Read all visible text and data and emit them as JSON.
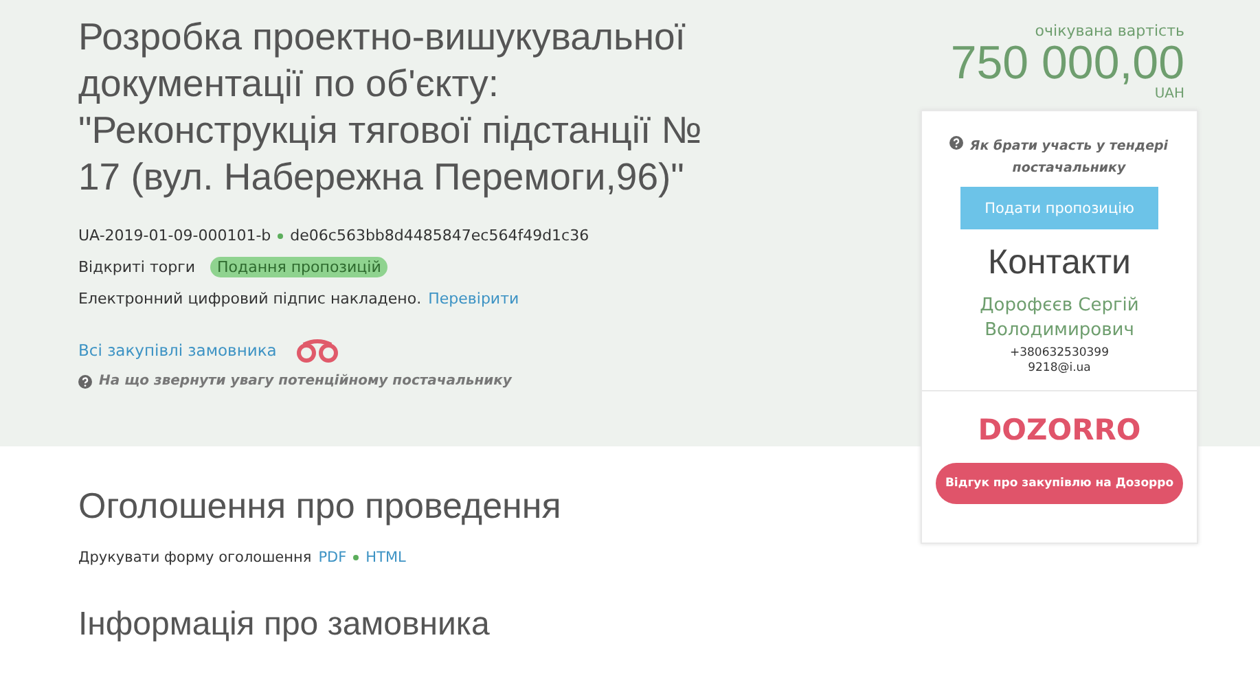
{
  "tender": {
    "title": "Розробка проектно-вишукувальної документації по об'єкту: \"Реконструкція тягової підстанції № 17 (вул. Набережна Перемоги,96)\"",
    "id": "UA-2019-01-09-000101-b",
    "hash": "de06c563bb8d4485847ec564f49d1c36",
    "procedure": "Відкриті торги",
    "status": "Подання пропозицій",
    "signature_text": "Електронний цифровий підпис накладено.",
    "signature_link": "Перевірити",
    "buyer_link": "Всі закупівлі замовника",
    "hint": "На що звернути увагу потенційному постачальнику"
  },
  "price": {
    "label": "очікувана вартість",
    "amount": "750 000,00",
    "currency": "UAH"
  },
  "card": {
    "help": "Як брати участь у тендері постачальнику",
    "submit_button": "Подати пропозицію",
    "contacts_title": "Контакти",
    "contact_name": "Дорофєєв Сергій Володимирович",
    "phone": "+380632530399",
    "email": "9218@i.ua",
    "logo": "DOZORRO",
    "feedback_button": "Відгук про закупівлю на Дозорро"
  },
  "sections": [
    {
      "kind": "announcement",
      "title": "Оголошення про проведення",
      "print_label": "Друкувати форму оголошення",
      "links": [
        "PDF",
        "HTML"
      ]
    },
    {
      "kind": "heading",
      "title": "Інформація про замовника"
    }
  ]
}
